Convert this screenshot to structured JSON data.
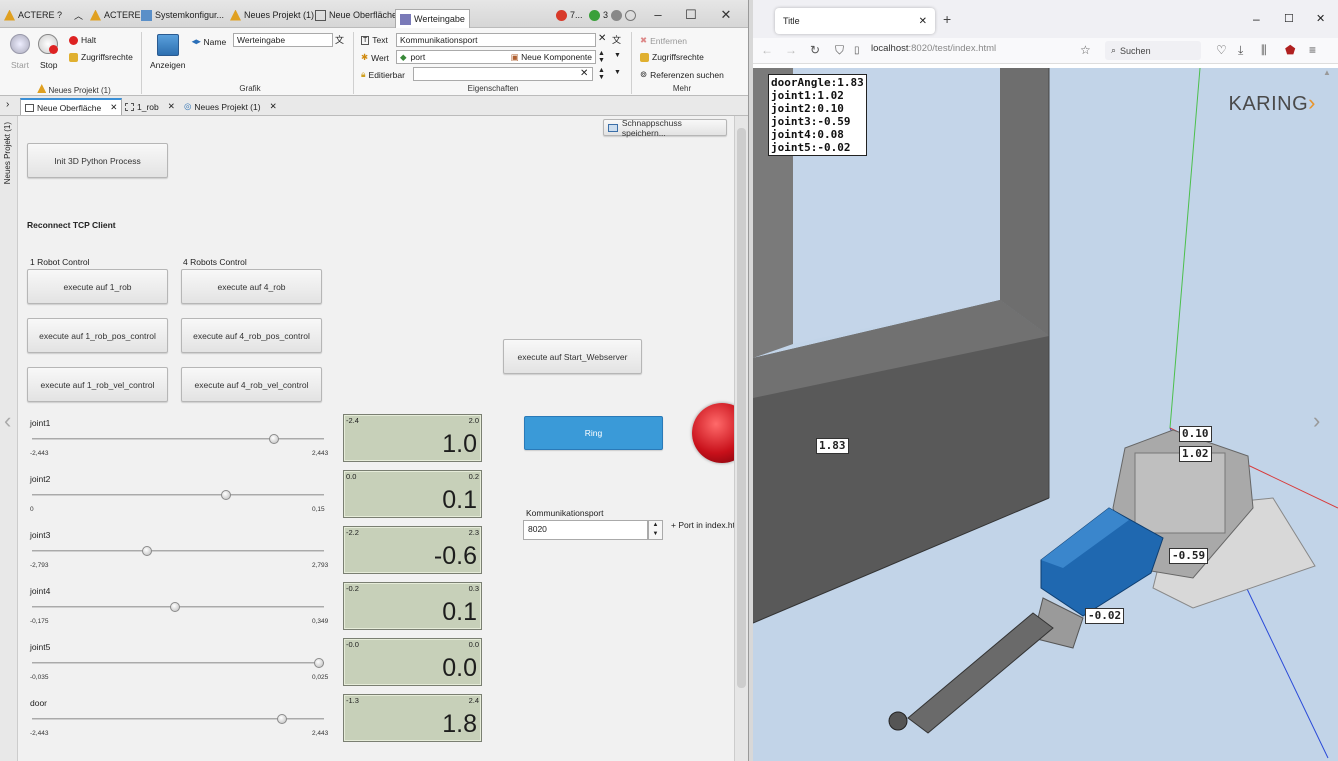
{
  "left_app": {
    "title_tabs": [
      "ACTERE ?",
      "ACTERE",
      "Systemkonfigur...",
      "Neues Projekt (1)",
      "Neue Oberfläche",
      "Werteingabe"
    ],
    "status": {
      "errors": "7...",
      "updates": "3"
    },
    "ribbon": {
      "start": "Start",
      "stop": "Stop",
      "halt": "Halt",
      "access_rights": "Zugriffsrechte",
      "group_project": "Neues Projekt (1)",
      "show": "Anzeigen",
      "group_graphic": "Grafik",
      "name_label": "Name",
      "name_value": "Werteingabe",
      "text_label": "Text",
      "text_value": "Kommunikationsport",
      "value_label": "Wert",
      "value_value": "port",
      "new_component": "Neue Komponente",
      "editable_label": "Editierbar",
      "group_properties": "Eigenschaften",
      "remove": "Entfernen",
      "access_rights2": "Zugriffsrechte",
      "find_refs": "Referenzen suchen",
      "group_more": "Mehr"
    },
    "doc_tabs": [
      "Neue Oberfläche",
      "1_rob",
      "Neues Projekt (1)"
    ],
    "side_strip": "Neues Projekt (1)",
    "snapshot_button": "Schnappschuss speichern...",
    "init_button": "Init 3D Python Process",
    "reconnect_label": "Reconnect TCP Client",
    "one_robot_label": "1 Robot Control",
    "four_robot_label": "4 Robots Control",
    "buttons": {
      "exec_1rob": "execute auf 1_rob",
      "exec_4rob": "execute auf 4_rob",
      "exec_1rob_pos": "execute auf 1_rob_pos_control",
      "exec_4rob_pos": "execute auf 4_rob_pos_control",
      "exec_1rob_vel": "execute auf 1_rob_vel_control",
      "exec_4rob_vel": "execute auf 4_rob_vel_control",
      "exec_webserver": "execute auf Start_Webserver",
      "ring": "Ring"
    },
    "port_label": "Kommunikationsport",
    "port_value": "8020",
    "port_hint": "+ Port in index.ht",
    "sliders": [
      {
        "label": "joint1",
        "min": "-2,443",
        "max": "2,443",
        "position": 0.84,
        "lcd_min": "-2.4",
        "lcd_max": "2.0",
        "lcd_value": "1.0"
      },
      {
        "label": "joint2",
        "min": "0",
        "max": "0,15",
        "position": 0.67,
        "lcd_min": "0.0",
        "lcd_max": "0.2",
        "lcd_value": "0.1"
      },
      {
        "label": "joint3",
        "min": "-2,793",
        "max": "2,793",
        "position": 0.39,
        "lcd_min": "-2.2",
        "lcd_max": "2.3",
        "lcd_value": "-0.6"
      },
      {
        "label": "joint4",
        "min": "-0,175",
        "max": "0,349",
        "position": 0.49,
        "lcd_min": "-0.2",
        "lcd_max": "0.3",
        "lcd_value": "0.1"
      },
      {
        "label": "joint5",
        "min": "-0,035",
        "max": "0,025",
        "position": 1.0,
        "lcd_min": "-0.0",
        "lcd_max": "0.0",
        "lcd_value": "0.0"
      },
      {
        "label": "door",
        "min": "-2,443",
        "max": "2,443",
        "position": 0.87,
        "lcd_min": "-1.3",
        "lcd_max": "2.4",
        "lcd_value": "1.8"
      }
    ]
  },
  "browser": {
    "tab_title": "Title",
    "url_host": "localhost",
    "url_rest": ":8020/test/index.html",
    "search_placeholder": "Suchen",
    "readout": [
      "doorAngle:1.83",
      "joint1:1.02",
      "joint2:0.10",
      "joint3:-0.59",
      "joint4:0.08",
      "joint5:-0.02"
    ],
    "logo": "KARING",
    "tags": {
      "door": "1.83",
      "j2": "0.10",
      "j1": "1.02",
      "j3": "-0.59",
      "j5": "-0.02"
    }
  },
  "colors": {
    "accent": "#3a9ad8",
    "lamp": "#c8101a",
    "robot_blue": "#1f68b0"
  }
}
